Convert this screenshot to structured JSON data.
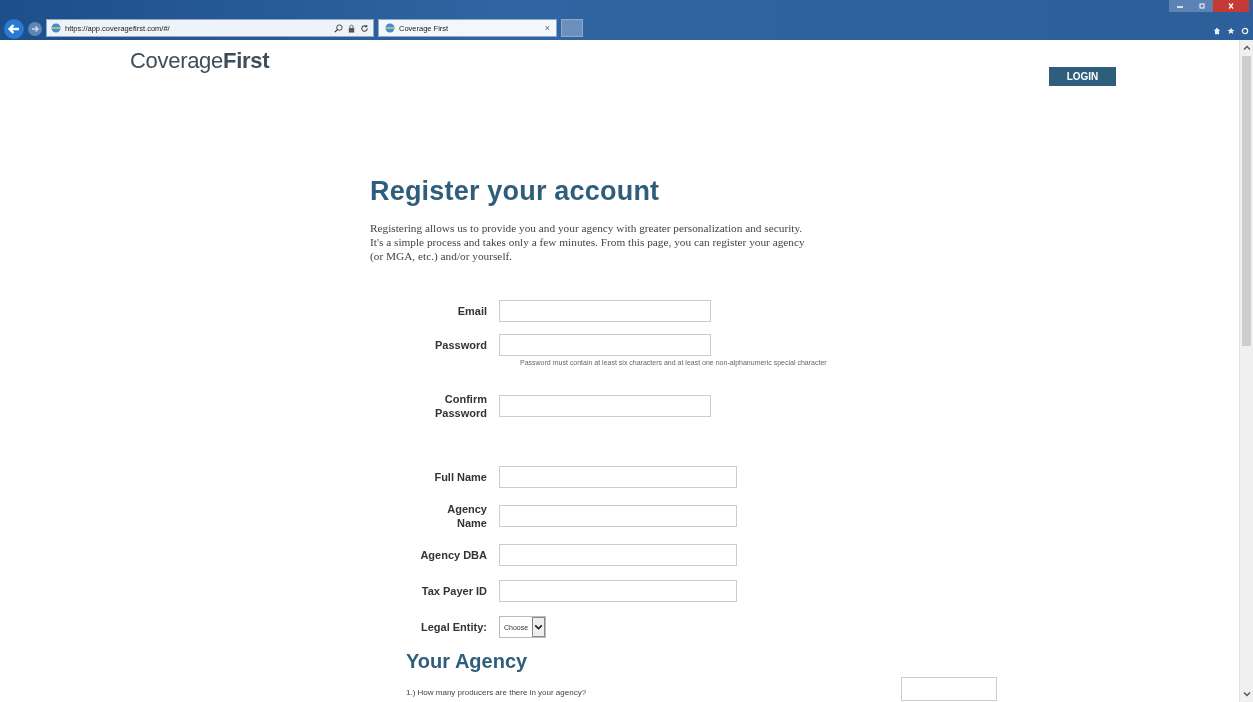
{
  "browser": {
    "url": "https://app.coveragefirst.com/#/",
    "tab_title": "Coverage First",
    "tab_close": "×"
  },
  "header": {
    "logo_regular": "Coverage",
    "logo_bold": "First",
    "login_button": "LOGIN"
  },
  "form": {
    "title": "Register your account",
    "intro": "Registering allows us to provide you and your agency with greater personalization and security. It's a simple process and takes only a few minutes. From this page, you can register your agency (or MGA, etc.) and/or yourself.",
    "account_fields": [
      {
        "label": "Email",
        "kind": "text"
      },
      {
        "label": "Password",
        "kind": "text",
        "hint": "Password must contain at least six characters and at least one non-alphanumeric special character"
      },
      {
        "label": "Confirm Password",
        "kind": "text"
      }
    ],
    "profile_fields": [
      {
        "label": "Full Name",
        "kind": "text"
      },
      {
        "label": "Agency Name",
        "kind": "text"
      },
      {
        "label": "Agency DBA",
        "kind": "text"
      },
      {
        "label": "Tax Payer ID",
        "kind": "text"
      },
      {
        "label": "Legal Entity:",
        "kind": "select",
        "value": "Choose"
      }
    ]
  },
  "agency": {
    "title": "Your Agency",
    "question": "1.) How many producers are there in your agency?"
  }
}
